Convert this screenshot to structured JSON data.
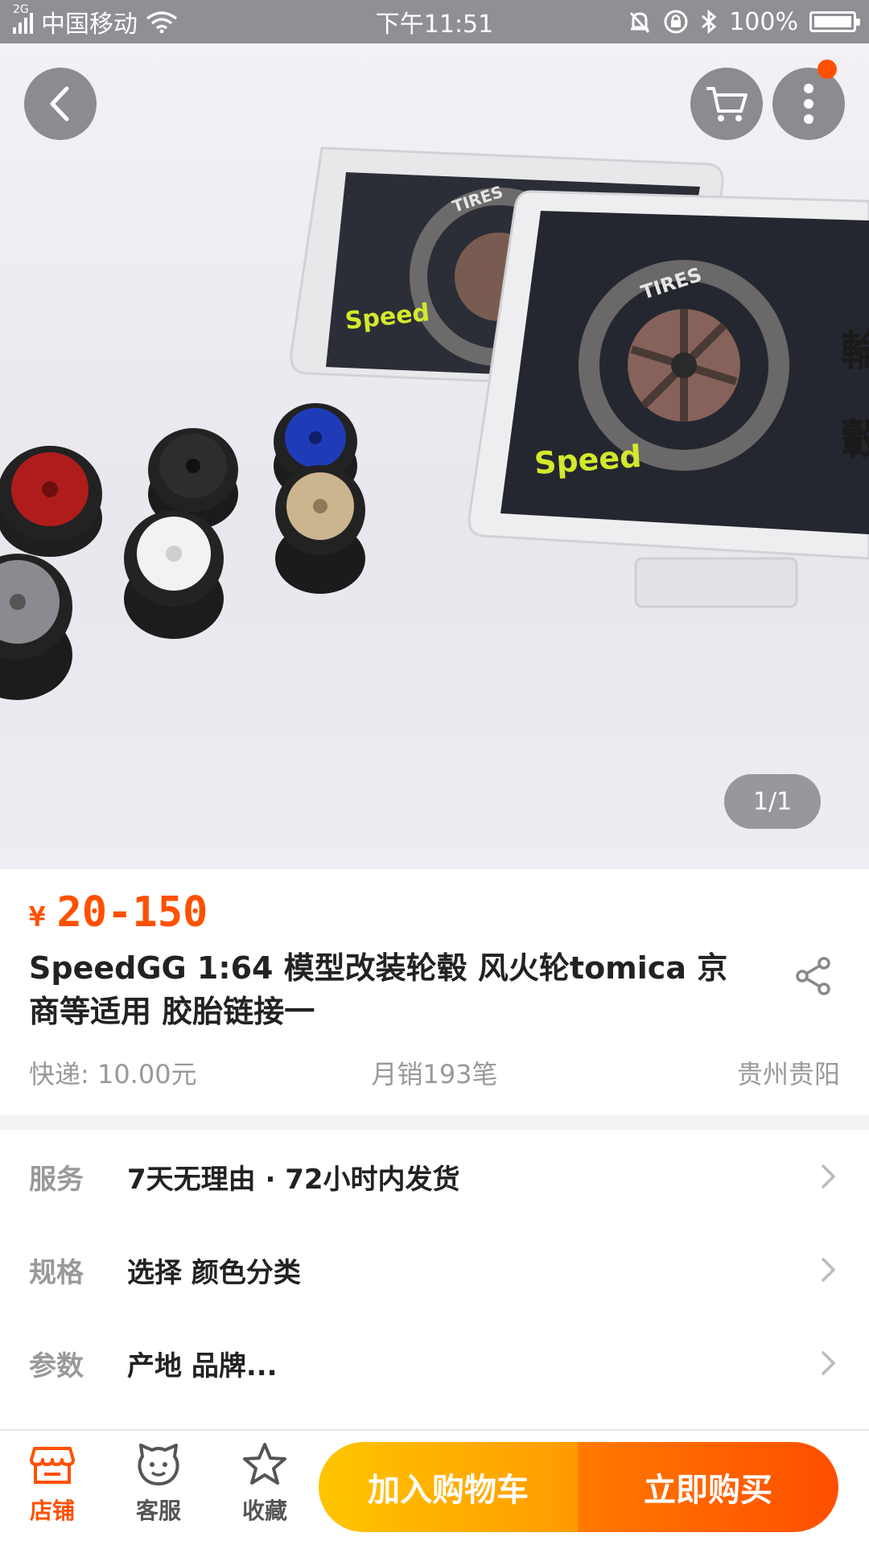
{
  "status_bar": {
    "network": "2G",
    "carrier": "中国移动",
    "time": "下午11:51",
    "battery": "100%"
  },
  "hero": {
    "page_indicator": "1/1",
    "product_image_text": {
      "brand": "Speed",
      "tires": "TIRES",
      "side_char_1": "輪",
      "side_char_2": "轂"
    }
  },
  "product": {
    "currency": "¥",
    "price": "20-150",
    "title": "SpeedGG 1:64 模型改装轮毂 风火轮tomica 京商等适用 胶胎链接一",
    "shipping": "快递: 10.00元",
    "monthly_sales": "月销193笔",
    "location": "贵州贵阳"
  },
  "options": {
    "service": {
      "label": "服务",
      "value": "7天无理由 · 72小时内发货"
    },
    "spec": {
      "label": "规格",
      "value": "选择 颜色分类"
    },
    "params": {
      "label": "参数",
      "value": "产地 品牌..."
    }
  },
  "bottom_bar": {
    "shop": "店铺",
    "customer_service": "客服",
    "favorite": "收藏",
    "add_to_cart": "加入购物车",
    "buy_now": "立即购买"
  },
  "colors": {
    "accent": "#ff5000",
    "cart_gradient": [
      "#ffc500",
      "#ff9a00"
    ],
    "buy_gradient": [
      "#ff7a00",
      "#ff4e00"
    ]
  }
}
